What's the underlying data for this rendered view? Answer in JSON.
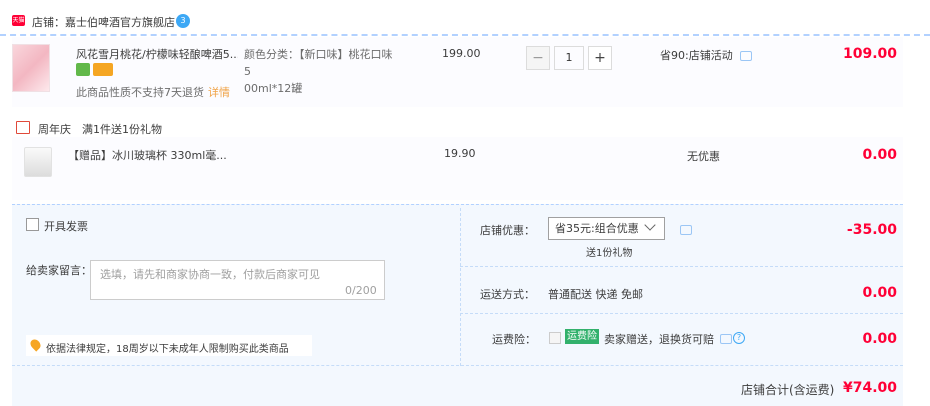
{
  "store": {
    "badge": "天猫",
    "label": "店铺：嘉士伯啤酒官方旗舰店",
    "ww_icon": "3"
  },
  "item": {
    "title": "风花雪月桃花/柠檬味轻酿啤酒5...",
    "note": "此商品性质不支持7天退货",
    "note_link": "详情",
    "sku_line1": "颜色分类：【新口味】桃花口味5",
    "sku_line2": "00ml*12罐",
    "price": "199.00",
    "qty": "1",
    "minus": "−",
    "plus": "+",
    "promo": "省90:店铺活动",
    "total": "109.00"
  },
  "gift_section": {
    "label": "周年庆　满1件送1份礼物",
    "title": "【赠品】冰川玻璃杯 330ml毫...",
    "price": "19.90",
    "no_discount": "无优惠",
    "total": "0.00"
  },
  "footer": {
    "invoice_label": "开具发票",
    "message_label": "给卖家留言：",
    "message_placeholder": "选填，请先和商家协商一致，付款后商家可见",
    "message_count": "0/200",
    "law_text": "依据法律规定，18周岁以下未成年人限制购买此类商品",
    "store_discount_label": "店铺优惠：",
    "store_discount_selected": "省35元:组合优惠",
    "store_discount_sub": "送1份礼物",
    "store_discount_value": "-35.00",
    "shipping_label": "运送方式：",
    "shipping_value": "普通配送 快递 免邮",
    "shipping_fee": "0.00",
    "insurance_label": "运费险：",
    "insurance_tag": "运费险",
    "insurance_text": "卖家赠送，退换货可赔",
    "insurance_help": "?",
    "insurance_fee": "0.00",
    "sum_label": "店铺合计(含运费)",
    "sum_value": "¥74.00"
  },
  "colors": {
    "accent_red": "#ff0036",
    "link_orange": "#f0a245",
    "footer_bg": "#f3f8fe",
    "insurance_green": "#32b16c"
  }
}
